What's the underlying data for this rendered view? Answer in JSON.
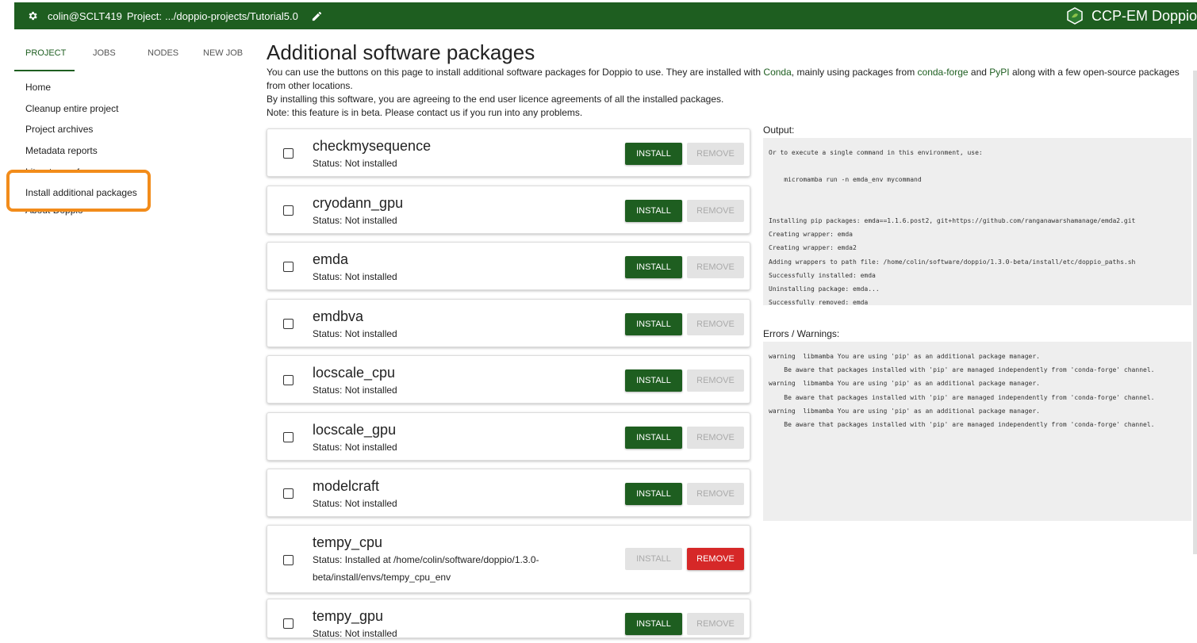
{
  "topbar": {
    "user": "colin@SCLT419",
    "project_label": "Project:",
    "project_path": ".../doppio-projects/Tutorial5.0",
    "brand": "CCP-EM Doppio",
    "icons": [
      "gear-icon",
      "pencil-icon",
      "ccpem-logo-icon"
    ]
  },
  "sidebar": {
    "tabs": [
      "PROJECT",
      "JOBS",
      "NODES",
      "NEW JOB"
    ],
    "active_tab": "PROJECT",
    "items": [
      "Home",
      "Cleanup entire project",
      "Project archives",
      "Metadata reports",
      "Literature references",
      "Install additional packages",
      "About Doppio"
    ],
    "highlighted_item": "Install additional packages",
    "highlight_color": "#f28c1b"
  },
  "main": {
    "title": "Additional software packages",
    "desc1_a": "You can use the buttons on this page to install additional software packages for Doppio to use. They are installed with ",
    "link_conda": "Conda",
    "desc1_b": ", mainly using packages from ",
    "link_condaforge": "conda-forge",
    "desc1_c": " and ",
    "link_pypi": "PyPI",
    "desc1_d": " along with a few open-source packages from other locations.",
    "desc2": "By installing this software, you are agreeing to the end user licence agreements of all the installed packages.",
    "desc3": "Note: this feature is in beta. Please contact us if you run into any problems.",
    "install_label": "INSTALL",
    "remove_label": "REMOVE",
    "packages": [
      {
        "name": "checkmysequence",
        "status": "Status: Not installed",
        "installed": false
      },
      {
        "name": "cryodann_gpu",
        "status": "Status: Not installed",
        "installed": false
      },
      {
        "name": "emda",
        "status": "Status: Not installed",
        "installed": false
      },
      {
        "name": "emdbva",
        "status": "Status: Not installed",
        "installed": false
      },
      {
        "name": "locscale_cpu",
        "status": "Status: Not installed",
        "installed": false
      },
      {
        "name": "locscale_gpu",
        "status": "Status: Not installed",
        "installed": false
      },
      {
        "name": "modelcraft",
        "status": "Status: Not installed",
        "installed": false
      },
      {
        "name": "tempy_cpu",
        "status": "Status: Installed at /home/colin/software/doppio/1.3.0-beta/install/envs/tempy_cpu_env",
        "installed": true
      },
      {
        "name": "tempy_gpu",
        "status": "Status: Not installed",
        "installed": false
      }
    ],
    "output_label": "Output:",
    "output_lines": [
      "Or to execute a single command in this environment, use:",
      "",
      "    micromamba run -n emda_env mycommand",
      "",
      "",
      "Installing pip packages: emda==1.1.6.post2, git+https://github.com/ranganawarshamanage/emda2.git",
      "Creating wrapper: emda",
      "Creating wrapper: emda2",
      "Adding wrappers to path file: /home/colin/software/doppio/1.3.0-beta/install/etc/doppio_paths.sh",
      "Successfully installed: emda",
      "Uninstalling package: emda...",
      "Successfully removed: emda"
    ],
    "errors_label": "Errors / Warnings:",
    "error_lines": [
      "warning  libmamba You are using 'pip' as an additional package manager.",
      "    Be aware that packages installed with 'pip' are managed independently from 'conda-forge' channel.",
      "warning  libmamba You are using 'pip' as an additional package manager.",
      "    Be aware that packages installed with 'pip' are managed independently from 'conda-forge' channel.",
      "warning  libmamba You are using 'pip' as an additional package manager.",
      "    Be aware that packages installed with 'pip' are managed independently from 'conda-forge' channel."
    ]
  },
  "colors": {
    "brand_green": "#1e5e20",
    "remove_red": "#d62828",
    "disabled_gray": "#e3e3e3"
  }
}
